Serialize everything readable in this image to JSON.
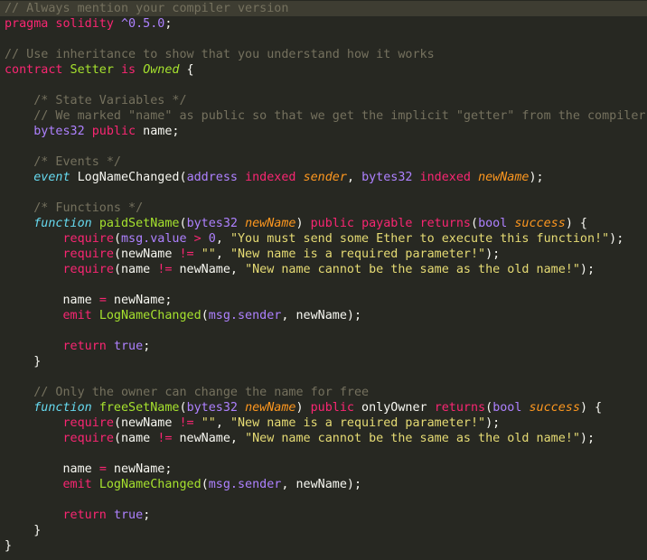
{
  "editor": {
    "theme": {
      "background": "#272822",
      "foreground": "#f8f8f2",
      "comment": "#75715e",
      "keyword": "#f92672",
      "builtin": "#66d9ef",
      "function": "#a6e22e",
      "string": "#e6db74",
      "number": "#ae81ff",
      "parameter": "#fd971f"
    },
    "lines": [
      [
        {
          "t": "// Always mention your compiler version",
          "c": "tok-comment"
        }
      ],
      [
        {
          "t": "pragma solidity ",
          "c": "tok-kw"
        },
        {
          "t": "^0.5.0",
          "c": "tok-type"
        },
        {
          "t": ";",
          "c": "tok-plain"
        }
      ],
      [],
      [
        {
          "t": "// Use inheritance to show that you understand how it works",
          "c": "tok-comment"
        }
      ],
      [
        {
          "t": "contract",
          "c": "tok-kw"
        },
        {
          "t": " Setter ",
          "c": "tok-fn"
        },
        {
          "t": "is",
          "c": "tok-kw"
        },
        {
          "t": " ",
          "c": "tok-plain"
        },
        {
          "t": "Owned",
          "c": "tok-inherit"
        },
        {
          "t": " {",
          "c": "tok-plain"
        }
      ],
      [],
      [
        {
          "t": "    /* State Variables */",
          "c": "tok-comment"
        }
      ],
      [
        {
          "t": "    // We marked \"name\" as public so that we get the implicit \"getter\" from the compiler",
          "c": "tok-comment"
        }
      ],
      [
        {
          "t": "    ",
          "c": "tok-plain"
        },
        {
          "t": "bytes32",
          "c": "tok-type"
        },
        {
          "t": " ",
          "c": "tok-plain"
        },
        {
          "t": "public",
          "c": "tok-kw"
        },
        {
          "t": " name;",
          "c": "tok-plain"
        }
      ],
      [],
      [
        {
          "t": "    /* Events */",
          "c": "tok-comment"
        }
      ],
      [
        {
          "t": "    ",
          "c": "tok-plain"
        },
        {
          "t": "event",
          "c": "tok-ital"
        },
        {
          "t": " LogNameChanged(",
          "c": "tok-plain"
        },
        {
          "t": "address",
          "c": "tok-type"
        },
        {
          "t": " ",
          "c": "tok-plain"
        },
        {
          "t": "indexed",
          "c": "tok-kw"
        },
        {
          "t": " ",
          "c": "tok-plain"
        },
        {
          "t": "sender",
          "c": "tok-param"
        },
        {
          "t": ", ",
          "c": "tok-plain"
        },
        {
          "t": "bytes32",
          "c": "tok-type"
        },
        {
          "t": " ",
          "c": "tok-plain"
        },
        {
          "t": "indexed",
          "c": "tok-kw"
        },
        {
          "t": " ",
          "c": "tok-plain"
        },
        {
          "t": "newName",
          "c": "tok-param"
        },
        {
          "t": ");",
          "c": "tok-plain"
        }
      ],
      [],
      [
        {
          "t": "    /* Functions */",
          "c": "tok-comment"
        }
      ],
      [
        {
          "t": "    ",
          "c": "tok-plain"
        },
        {
          "t": "function",
          "c": "tok-ital"
        },
        {
          "t": " ",
          "c": "tok-plain"
        },
        {
          "t": "paidSetName",
          "c": "tok-fn"
        },
        {
          "t": "(",
          "c": "tok-plain"
        },
        {
          "t": "bytes32",
          "c": "tok-type"
        },
        {
          "t": " ",
          "c": "tok-plain"
        },
        {
          "t": "newName",
          "c": "tok-param"
        },
        {
          "t": ") ",
          "c": "tok-plain"
        },
        {
          "t": "public",
          "c": "tok-kw"
        },
        {
          "t": " ",
          "c": "tok-plain"
        },
        {
          "t": "payable",
          "c": "tok-kw"
        },
        {
          "t": " ",
          "c": "tok-plain"
        },
        {
          "t": "returns",
          "c": "tok-kw"
        },
        {
          "t": "(",
          "c": "tok-plain"
        },
        {
          "t": "bool",
          "c": "tok-type"
        },
        {
          "t": " ",
          "c": "tok-plain"
        },
        {
          "t": "success",
          "c": "tok-param"
        },
        {
          "t": ") {",
          "c": "tok-plain"
        }
      ],
      [
        {
          "t": "        ",
          "c": "tok-plain"
        },
        {
          "t": "require",
          "c": "tok-kw"
        },
        {
          "t": "(",
          "c": "tok-plain"
        },
        {
          "t": "msg.value",
          "c": "tok-type"
        },
        {
          "t": " ",
          "c": "tok-plain"
        },
        {
          "t": ">",
          "c": "tok-kw"
        },
        {
          "t": " ",
          "c": "tok-plain"
        },
        {
          "t": "0",
          "c": "tok-num"
        },
        {
          "t": ", ",
          "c": "tok-plain"
        },
        {
          "t": "\"You must send some Ether to execute this function!\"",
          "c": "tok-str"
        },
        {
          "t": ");",
          "c": "tok-plain"
        }
      ],
      [
        {
          "t": "        ",
          "c": "tok-plain"
        },
        {
          "t": "require",
          "c": "tok-kw"
        },
        {
          "t": "(newName ",
          "c": "tok-plain"
        },
        {
          "t": "!=",
          "c": "tok-kw"
        },
        {
          "t": " ",
          "c": "tok-plain"
        },
        {
          "t": "\"\"",
          "c": "tok-str"
        },
        {
          "t": ", ",
          "c": "tok-plain"
        },
        {
          "t": "\"New name is a required parameter!\"",
          "c": "tok-str"
        },
        {
          "t": ");",
          "c": "tok-plain"
        }
      ],
      [
        {
          "t": "        ",
          "c": "tok-plain"
        },
        {
          "t": "require",
          "c": "tok-kw"
        },
        {
          "t": "(name ",
          "c": "tok-plain"
        },
        {
          "t": "!=",
          "c": "tok-kw"
        },
        {
          "t": " newName, ",
          "c": "tok-plain"
        },
        {
          "t": "\"New name cannot be the same as the old name!\"",
          "c": "tok-str"
        },
        {
          "t": ");",
          "c": "tok-plain"
        }
      ],
      [],
      [
        {
          "t": "        name ",
          "c": "tok-plain"
        },
        {
          "t": "=",
          "c": "tok-kw"
        },
        {
          "t": " newName;",
          "c": "tok-plain"
        }
      ],
      [
        {
          "t": "        ",
          "c": "tok-plain"
        },
        {
          "t": "emit",
          "c": "tok-kw"
        },
        {
          "t": " ",
          "c": "tok-plain"
        },
        {
          "t": "LogNameChanged",
          "c": "tok-fn"
        },
        {
          "t": "(",
          "c": "tok-plain"
        },
        {
          "t": "msg.sender",
          "c": "tok-type"
        },
        {
          "t": ", newName);",
          "c": "tok-plain"
        }
      ],
      [],
      [
        {
          "t": "        ",
          "c": "tok-plain"
        },
        {
          "t": "return",
          "c": "tok-kw"
        },
        {
          "t": " ",
          "c": "tok-plain"
        },
        {
          "t": "true",
          "c": "tok-type"
        },
        {
          "t": ";",
          "c": "tok-plain"
        }
      ],
      [
        {
          "t": "    }",
          "c": "tok-plain"
        }
      ],
      [],
      [
        {
          "t": "    // Only the owner can change the name for free",
          "c": "tok-comment"
        }
      ],
      [
        {
          "t": "    ",
          "c": "tok-plain"
        },
        {
          "t": "function",
          "c": "tok-ital"
        },
        {
          "t": " ",
          "c": "tok-plain"
        },
        {
          "t": "freeSetName",
          "c": "tok-fn"
        },
        {
          "t": "(",
          "c": "tok-plain"
        },
        {
          "t": "bytes32",
          "c": "tok-type"
        },
        {
          "t": " ",
          "c": "tok-plain"
        },
        {
          "t": "newName",
          "c": "tok-param"
        },
        {
          "t": ") ",
          "c": "tok-plain"
        },
        {
          "t": "public",
          "c": "tok-kw"
        },
        {
          "t": " onlyOwner ",
          "c": "tok-plain"
        },
        {
          "t": "returns",
          "c": "tok-kw"
        },
        {
          "t": "(",
          "c": "tok-plain"
        },
        {
          "t": "bool",
          "c": "tok-type"
        },
        {
          "t": " ",
          "c": "tok-plain"
        },
        {
          "t": "success",
          "c": "tok-param"
        },
        {
          "t": ") {",
          "c": "tok-plain"
        }
      ],
      [
        {
          "t": "        ",
          "c": "tok-plain"
        },
        {
          "t": "require",
          "c": "tok-kw"
        },
        {
          "t": "(newName ",
          "c": "tok-plain"
        },
        {
          "t": "!=",
          "c": "tok-kw"
        },
        {
          "t": " ",
          "c": "tok-plain"
        },
        {
          "t": "\"\"",
          "c": "tok-str"
        },
        {
          "t": ", ",
          "c": "tok-plain"
        },
        {
          "t": "\"New name is a required parameter!\"",
          "c": "tok-str"
        },
        {
          "t": ");",
          "c": "tok-plain"
        }
      ],
      [
        {
          "t": "        ",
          "c": "tok-plain"
        },
        {
          "t": "require",
          "c": "tok-kw"
        },
        {
          "t": "(name ",
          "c": "tok-plain"
        },
        {
          "t": "!=",
          "c": "tok-kw"
        },
        {
          "t": " newName, ",
          "c": "tok-plain"
        },
        {
          "t": "\"New name cannot be the same as the old name!\"",
          "c": "tok-str"
        },
        {
          "t": ");",
          "c": "tok-plain"
        }
      ],
      [],
      [
        {
          "t": "        name ",
          "c": "tok-plain"
        },
        {
          "t": "=",
          "c": "tok-kw"
        },
        {
          "t": " newName;",
          "c": "tok-plain"
        }
      ],
      [
        {
          "t": "        ",
          "c": "tok-plain"
        },
        {
          "t": "emit",
          "c": "tok-kw"
        },
        {
          "t": " ",
          "c": "tok-plain"
        },
        {
          "t": "LogNameChanged",
          "c": "tok-fn"
        },
        {
          "t": "(",
          "c": "tok-plain"
        },
        {
          "t": "msg.sender",
          "c": "tok-type"
        },
        {
          "t": ", newName);",
          "c": "tok-plain"
        }
      ],
      [],
      [
        {
          "t": "        ",
          "c": "tok-plain"
        },
        {
          "t": "return",
          "c": "tok-kw"
        },
        {
          "t": " ",
          "c": "tok-plain"
        },
        {
          "t": "true",
          "c": "tok-type"
        },
        {
          "t": ";",
          "c": "tok-plain"
        }
      ],
      [
        {
          "t": "    }",
          "c": "tok-plain"
        }
      ],
      [
        {
          "t": "}",
          "c": "tok-plain"
        }
      ]
    ]
  }
}
